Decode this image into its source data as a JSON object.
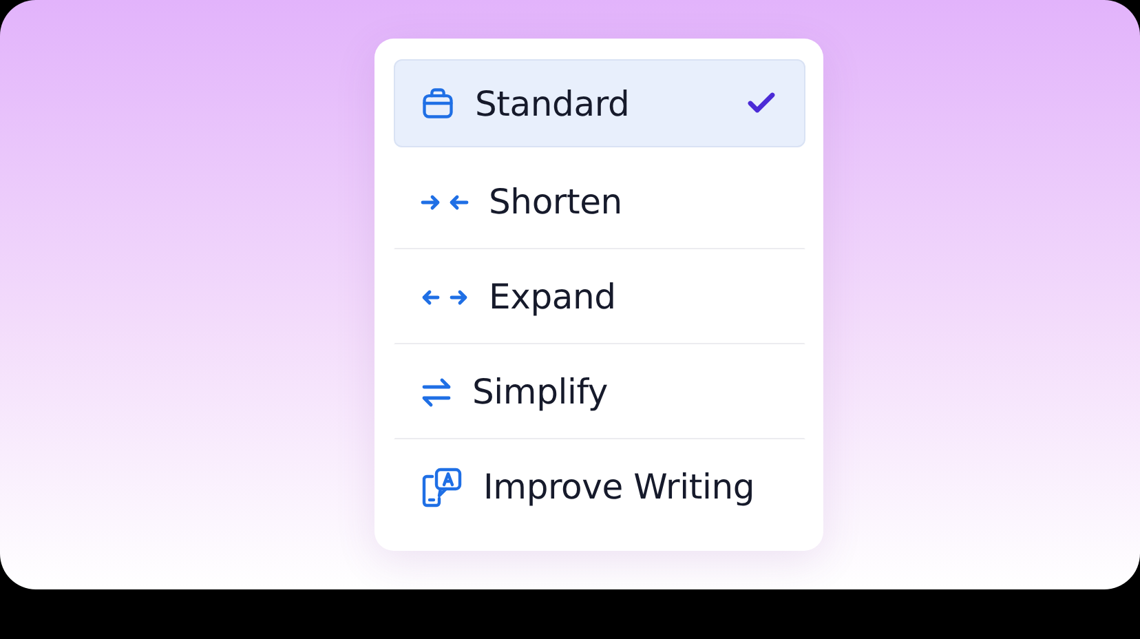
{
  "menu": {
    "items": [
      {
        "label": "Standard",
        "selected": true
      },
      {
        "label": "Shorten",
        "selected": false
      },
      {
        "label": "Expand",
        "selected": false
      },
      {
        "label": "Simplify",
        "selected": false
      },
      {
        "label": "Improve Writing",
        "selected": false
      }
    ]
  }
}
